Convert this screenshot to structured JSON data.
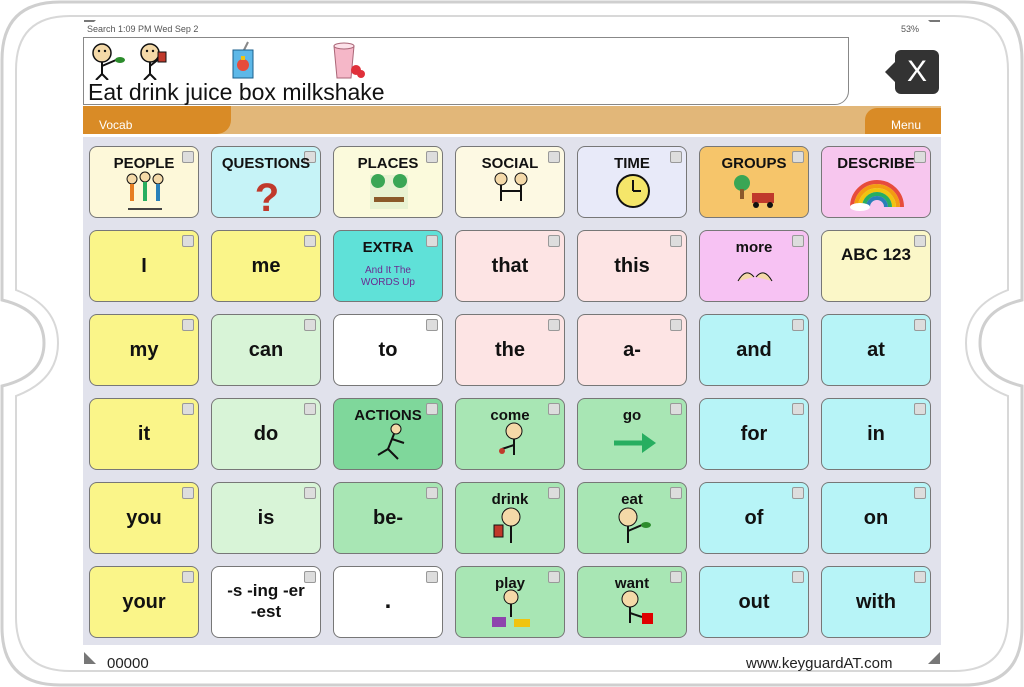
{
  "status": {
    "left": "Search   1:09 PM   Wed Sep 2",
    "right": "53%"
  },
  "message": {
    "text": "Eat drink juice box milkshake",
    "icon_names": [
      "eat-icon",
      "drink-icon",
      "juice-box-icon",
      "milkshake-icon"
    ]
  },
  "clear_button": {
    "label": "X"
  },
  "tabs": {
    "vocab": "Vocab",
    "menu": "Menu"
  },
  "grid": {
    "rows": [
      [
        {
          "label": "PEOPLE",
          "style": "cat",
          "color": "#fdf8d9",
          "icon": "people-icon"
        },
        {
          "label": "QUESTIONS",
          "style": "cat",
          "color": "#c6f3f7",
          "icon": "question-mark-icon"
        },
        {
          "label": "PLACES",
          "style": "cat",
          "color": "#fbfadc",
          "icon": "park-icon"
        },
        {
          "label": "SOCIAL",
          "style": "cat",
          "color": "#fdf9e3",
          "icon": "friends-icon"
        },
        {
          "label": "TIME",
          "style": "cat",
          "color": "#e8eaf9",
          "icon": "clock-icon"
        },
        {
          "label": "GROUPS",
          "style": "cat",
          "color": "#f6c56a",
          "icon": "groups-icon"
        },
        {
          "label": "DESCRIBE",
          "style": "cat",
          "color": "#f7c6ee",
          "icon": "rainbow-icon"
        }
      ],
      [
        {
          "label": "I",
          "style": "word",
          "color": "#faf589",
          "icon": ""
        },
        {
          "label": "me",
          "style": "word",
          "color": "#faf589",
          "icon": ""
        },
        {
          "label": "EXTRA",
          "style": "cat",
          "color": "#5fe1d8",
          "icon": "extra-words-icon"
        },
        {
          "label": "that",
          "style": "word",
          "color": "#fde4e4",
          "icon": ""
        },
        {
          "label": "this",
          "style": "word",
          "color": "#fde4e4",
          "icon": ""
        },
        {
          "label": "more",
          "style": "cat",
          "color": "#f7c2f3",
          "icon": "more-hands-icon"
        },
        {
          "label": "ABC 123",
          "style": "two",
          "color": "#fbf7c8",
          "icon": ""
        }
      ],
      [
        {
          "label": "my",
          "style": "word",
          "color": "#faf589",
          "icon": ""
        },
        {
          "label": "can",
          "style": "word",
          "color": "#d8f4d7",
          "icon": ""
        },
        {
          "label": "to",
          "style": "word",
          "color": "#ffffff",
          "icon": ""
        },
        {
          "label": "the",
          "style": "word",
          "color": "#fde4e4",
          "icon": ""
        },
        {
          "label": "a-",
          "style": "word",
          "color": "#fde4e4",
          "icon": ""
        },
        {
          "label": "and",
          "style": "word",
          "color": "#b7f4f7",
          "icon": ""
        },
        {
          "label": "at",
          "style": "word",
          "color": "#b7f4f7",
          "icon": ""
        }
      ],
      [
        {
          "label": "it",
          "style": "word",
          "color": "#faf589",
          "icon": ""
        },
        {
          "label": "do",
          "style": "word",
          "color": "#d8f4d7",
          "icon": ""
        },
        {
          "label": "ACTIONS",
          "style": "cat",
          "color": "#7fd79b",
          "icon": "running-icon"
        },
        {
          "label": "come",
          "style": "cat",
          "color": "#a8e6b4",
          "icon": "come-icon"
        },
        {
          "label": "go",
          "style": "cat",
          "color": "#a8e6b4",
          "icon": "arrow-right-icon"
        },
        {
          "label": "for",
          "style": "word",
          "color": "#b7f4f7",
          "icon": ""
        },
        {
          "label": "in",
          "style": "word",
          "color": "#b7f4f7",
          "icon": ""
        }
      ],
      [
        {
          "label": "you",
          "style": "word",
          "color": "#faf589",
          "icon": ""
        },
        {
          "label": "is",
          "style": "word",
          "color": "#d8f4d7",
          "icon": ""
        },
        {
          "label": "be-",
          "style": "word",
          "color": "#a8e6b4",
          "icon": ""
        },
        {
          "label": "drink",
          "style": "cat",
          "color": "#a8e6b4",
          "icon": "drink-icon"
        },
        {
          "label": "eat",
          "style": "cat",
          "color": "#a8e6b4",
          "icon": "eat-icon"
        },
        {
          "label": "of",
          "style": "word",
          "color": "#b7f4f7",
          "icon": ""
        },
        {
          "label": "on",
          "style": "word",
          "color": "#b7f4f7",
          "icon": ""
        }
      ],
      [
        {
          "label": "your",
          "style": "word",
          "color": "#faf589",
          "icon": ""
        },
        {
          "label": "-s -ing -er -est",
          "style": "two",
          "color": "#ffffff",
          "icon": ""
        },
        {
          "label": ".",
          "style": "dot",
          "color": "#ffffff",
          "icon": ""
        },
        {
          "label": "play",
          "style": "cat",
          "color": "#a8e6b4",
          "icon": "play-icon"
        },
        {
          "label": "want",
          "style": "cat",
          "color": "#a8e6b4",
          "icon": "want-icon"
        },
        {
          "label": "out",
          "style": "word",
          "color": "#b7f4f7",
          "icon": ""
        },
        {
          "label": "with",
          "style": "word",
          "color": "#b7f4f7",
          "icon": ""
        }
      ]
    ]
  },
  "extra_sub": "And It The WORDS Up",
  "footer": {
    "code": "00000",
    "url": "www.keyguardAT.com"
  }
}
